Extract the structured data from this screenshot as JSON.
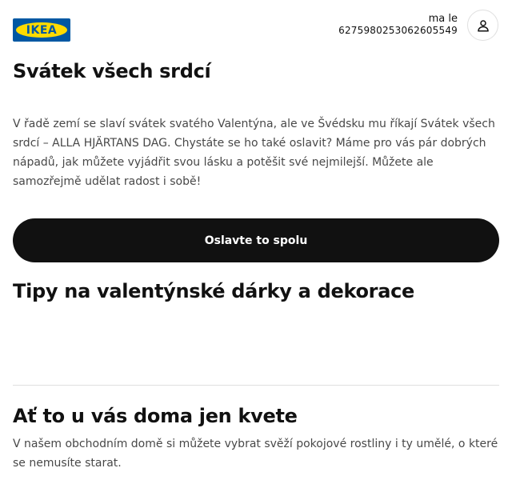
{
  "header": {
    "logo_text": "IKEA",
    "user_name": "ma le",
    "user_id": "6275980253062605549",
    "profile_icon": "person-icon"
  },
  "section_valentine": {
    "title": "Svátek všech srdcí",
    "text": "V řadě zemí se slaví svátek svatého Valentýna, ale ve Švédsku mu říkají Svátek všech srdcí – ALLA HJÄRTANS DAG. Chystáte se ho také oslavit? Máme pro vás pár dobrých nápadů, jak můžete vyjádřit svou lásku a potěšit své nejmilejší. Můžete ale samozřejmě udělat radost i sobě!",
    "cta_label": "Oslavte to spolu"
  },
  "section_gifts": {
    "title": "Tipy na valentýnské dárky a dekorace"
  },
  "section_plants": {
    "title": "Ať to u vás doma jen kvete",
    "text": "V našem obchodním domě si můžete vybrat svěží pokojové rostliny i ty umělé, o které se nemusíte starat."
  },
  "colors": {
    "brand_blue": "#0058a3",
    "brand_yellow": "#ffdb00",
    "button_bg": "#111111",
    "body_text": "#484848"
  }
}
